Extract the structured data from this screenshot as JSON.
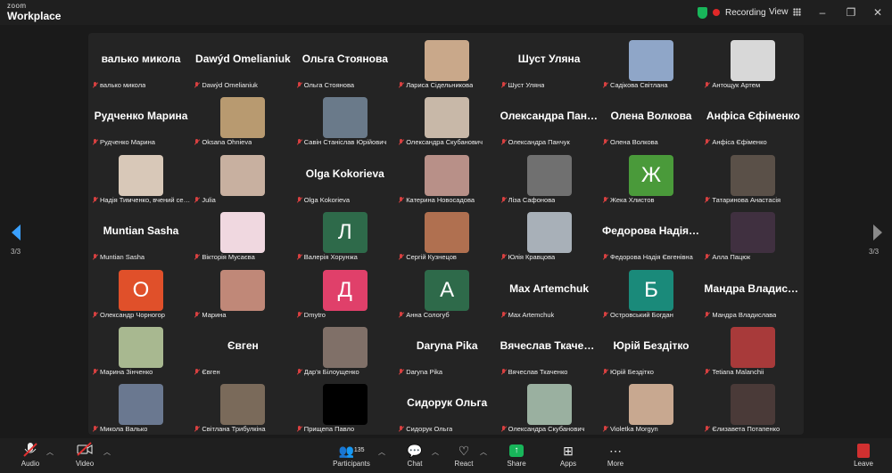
{
  "app": {
    "logo_small": "zoom",
    "logo_big": "Workplace"
  },
  "topbar": {
    "recording_label": "Recording",
    "view_label": "View"
  },
  "pagination": {
    "left": "3/3",
    "right": "3/3"
  },
  "participants": [
    {
      "display": "валько микола",
      "label": "валько микола",
      "kind": "name"
    },
    {
      "display": "Dawýd Omelianiuk",
      "label": "Dawýd Omelianiuk",
      "kind": "name"
    },
    {
      "display": "Ольга Стоянова",
      "label": "Ольга Стоянова",
      "kind": "name"
    },
    {
      "display": "",
      "label": "Лариса Сідельникова",
      "kind": "photo",
      "color": "#c9a88a"
    },
    {
      "display": "Шуст Уляна",
      "label": "Шуст Уляна",
      "kind": "name"
    },
    {
      "display": "",
      "label": "Садікова Світлана",
      "kind": "photo",
      "color": "#8fa6c8"
    },
    {
      "display": "",
      "label": "Антощук Артем",
      "kind": "photo",
      "color": "#d8d8d8"
    },
    {
      "display": "Рудченко Марина",
      "label": "Рудченко Марина",
      "kind": "name"
    },
    {
      "display": "",
      "label": "Oksana Ohnieva",
      "kind": "photo",
      "color": "#b89a70"
    },
    {
      "display": "",
      "label": "Савін Станіслав Юрійович",
      "kind": "photo",
      "color": "#6a7a8a"
    },
    {
      "display": "",
      "label": "Олександра Скубанович",
      "kind": "photo",
      "color": "#c8b8a8"
    },
    {
      "display": "Олександра Панчук",
      "label": "Олександра Панчук",
      "kind": "name"
    },
    {
      "display": "Олена Волкова",
      "label": "Олена Волкова",
      "kind": "name"
    },
    {
      "display": "Анфіса Єфіменко",
      "label": "Анфіса Єфіменко",
      "kind": "name"
    },
    {
      "display": "",
      "label": "Надія Тимченко, вчений секретар",
      "kind": "photo",
      "color": "#d8c8b8"
    },
    {
      "display": "",
      "label": "Julia",
      "kind": "photo",
      "color": "#c8b0a0"
    },
    {
      "display": "Olga Kokorieva",
      "label": "Olga Kokorieva",
      "kind": "name"
    },
    {
      "display": "",
      "label": "Катерина Новосадова",
      "kind": "photo",
      "color": "#b89088"
    },
    {
      "display": "",
      "label": "Ліза Сафонова",
      "kind": "photo",
      "color": "#707070"
    },
    {
      "display": "Ж",
      "label": "Жека Хлистов",
      "kind": "avatar",
      "color": "#4a9a3a"
    },
    {
      "display": "",
      "label": "Татаринова Анастасія",
      "kind": "photo",
      "color": "#5a5048"
    },
    {
      "display": "Muntian Sasha",
      "label": "Muntian Sasha",
      "kind": "name"
    },
    {
      "display": "",
      "label": "Вікторія Мусаєва",
      "kind": "photo",
      "color": "#f0d8e0"
    },
    {
      "display": "Л",
      "label": "Валерія Хорунжа",
      "kind": "avatar",
      "color": "#2e6a4a"
    },
    {
      "display": "",
      "label": "Сергій Кузнецов",
      "kind": "photo",
      "color": "#b07050"
    },
    {
      "display": "",
      "label": "Юлія Кравцова",
      "kind": "photo",
      "color": "#a8b0b8"
    },
    {
      "display": "Федорова Надія Євгенівна",
      "label": "Федорова Надія Євгенівна",
      "kind": "name"
    },
    {
      "display": "",
      "label": "Алла Пацюк",
      "kind": "photo",
      "color": "#403040"
    },
    {
      "display": "О",
      "label": "Олександр Чорногор",
      "kind": "avatar",
      "color": "#e0502a"
    },
    {
      "display": "",
      "label": "Марина",
      "kind": "photo",
      "color": "#c08878"
    },
    {
      "display": "Д",
      "label": "Dmytro",
      "kind": "avatar",
      "color": "#e0406a"
    },
    {
      "display": "А",
      "label": "Анна Сологуб",
      "kind": "avatar",
      "color": "#2e6a4a"
    },
    {
      "display": "Max Artemchuk",
      "label": "Max Artemchuk",
      "kind": "name"
    },
    {
      "display": "Б",
      "label": "Островський Богдан",
      "kind": "avatar",
      "color": "#1a8a7a"
    },
    {
      "display": "Мандра Владислава",
      "label": "Мандра Владислава",
      "kind": "name"
    },
    {
      "display": "",
      "label": "Марина Зінченко",
      "kind": "photo",
      "color": "#a8b890"
    },
    {
      "display": "Євген",
      "label": "Євген",
      "kind": "name"
    },
    {
      "display": "",
      "label": "Дар'я Білоущенко",
      "kind": "photo",
      "color": "#807068"
    },
    {
      "display": "Daryna Pika",
      "label": "Daryna Pika",
      "kind": "name"
    },
    {
      "display": "Вячеслав Ткаченко",
      "label": "Вячеслав Ткаченко",
      "kind": "name"
    },
    {
      "display": "Юрій Бездітко",
      "label": "Юрій Бездітко",
      "kind": "name"
    },
    {
      "display": "",
      "label": "Tetiana Malanchii",
      "kind": "photo",
      "color": "#a83a3a"
    },
    {
      "display": "",
      "label": "Микола Валько",
      "kind": "photo",
      "color": "#6a7890"
    },
    {
      "display": "",
      "label": "Світлана Трибулкіна",
      "kind": "photo",
      "color": "#7a6a5a"
    },
    {
      "display": "",
      "label": "Прищепа Павло",
      "kind": "photo",
      "color": "#000000"
    },
    {
      "display": "Сидорук Ольга",
      "label": "Сидорук Ольга",
      "kind": "name"
    },
    {
      "display": "",
      "label": "Олександра Скубанович",
      "kind": "photo",
      "color": "#9ab0a0"
    },
    {
      "display": "",
      "label": "Violetka Morgyn",
      "kind": "photo",
      "color": "#c8a890"
    },
    {
      "display": "",
      "label": "Єлизавета Потапенко",
      "kind": "photo",
      "color": "#4a3a38"
    }
  ],
  "controls": {
    "audio": "Audio",
    "video": "Video",
    "participants": "Participants",
    "participants_count": "135",
    "chat": "Chat",
    "react": "React",
    "share": "Share",
    "apps": "Apps",
    "more": "More",
    "leave": "Leave"
  }
}
